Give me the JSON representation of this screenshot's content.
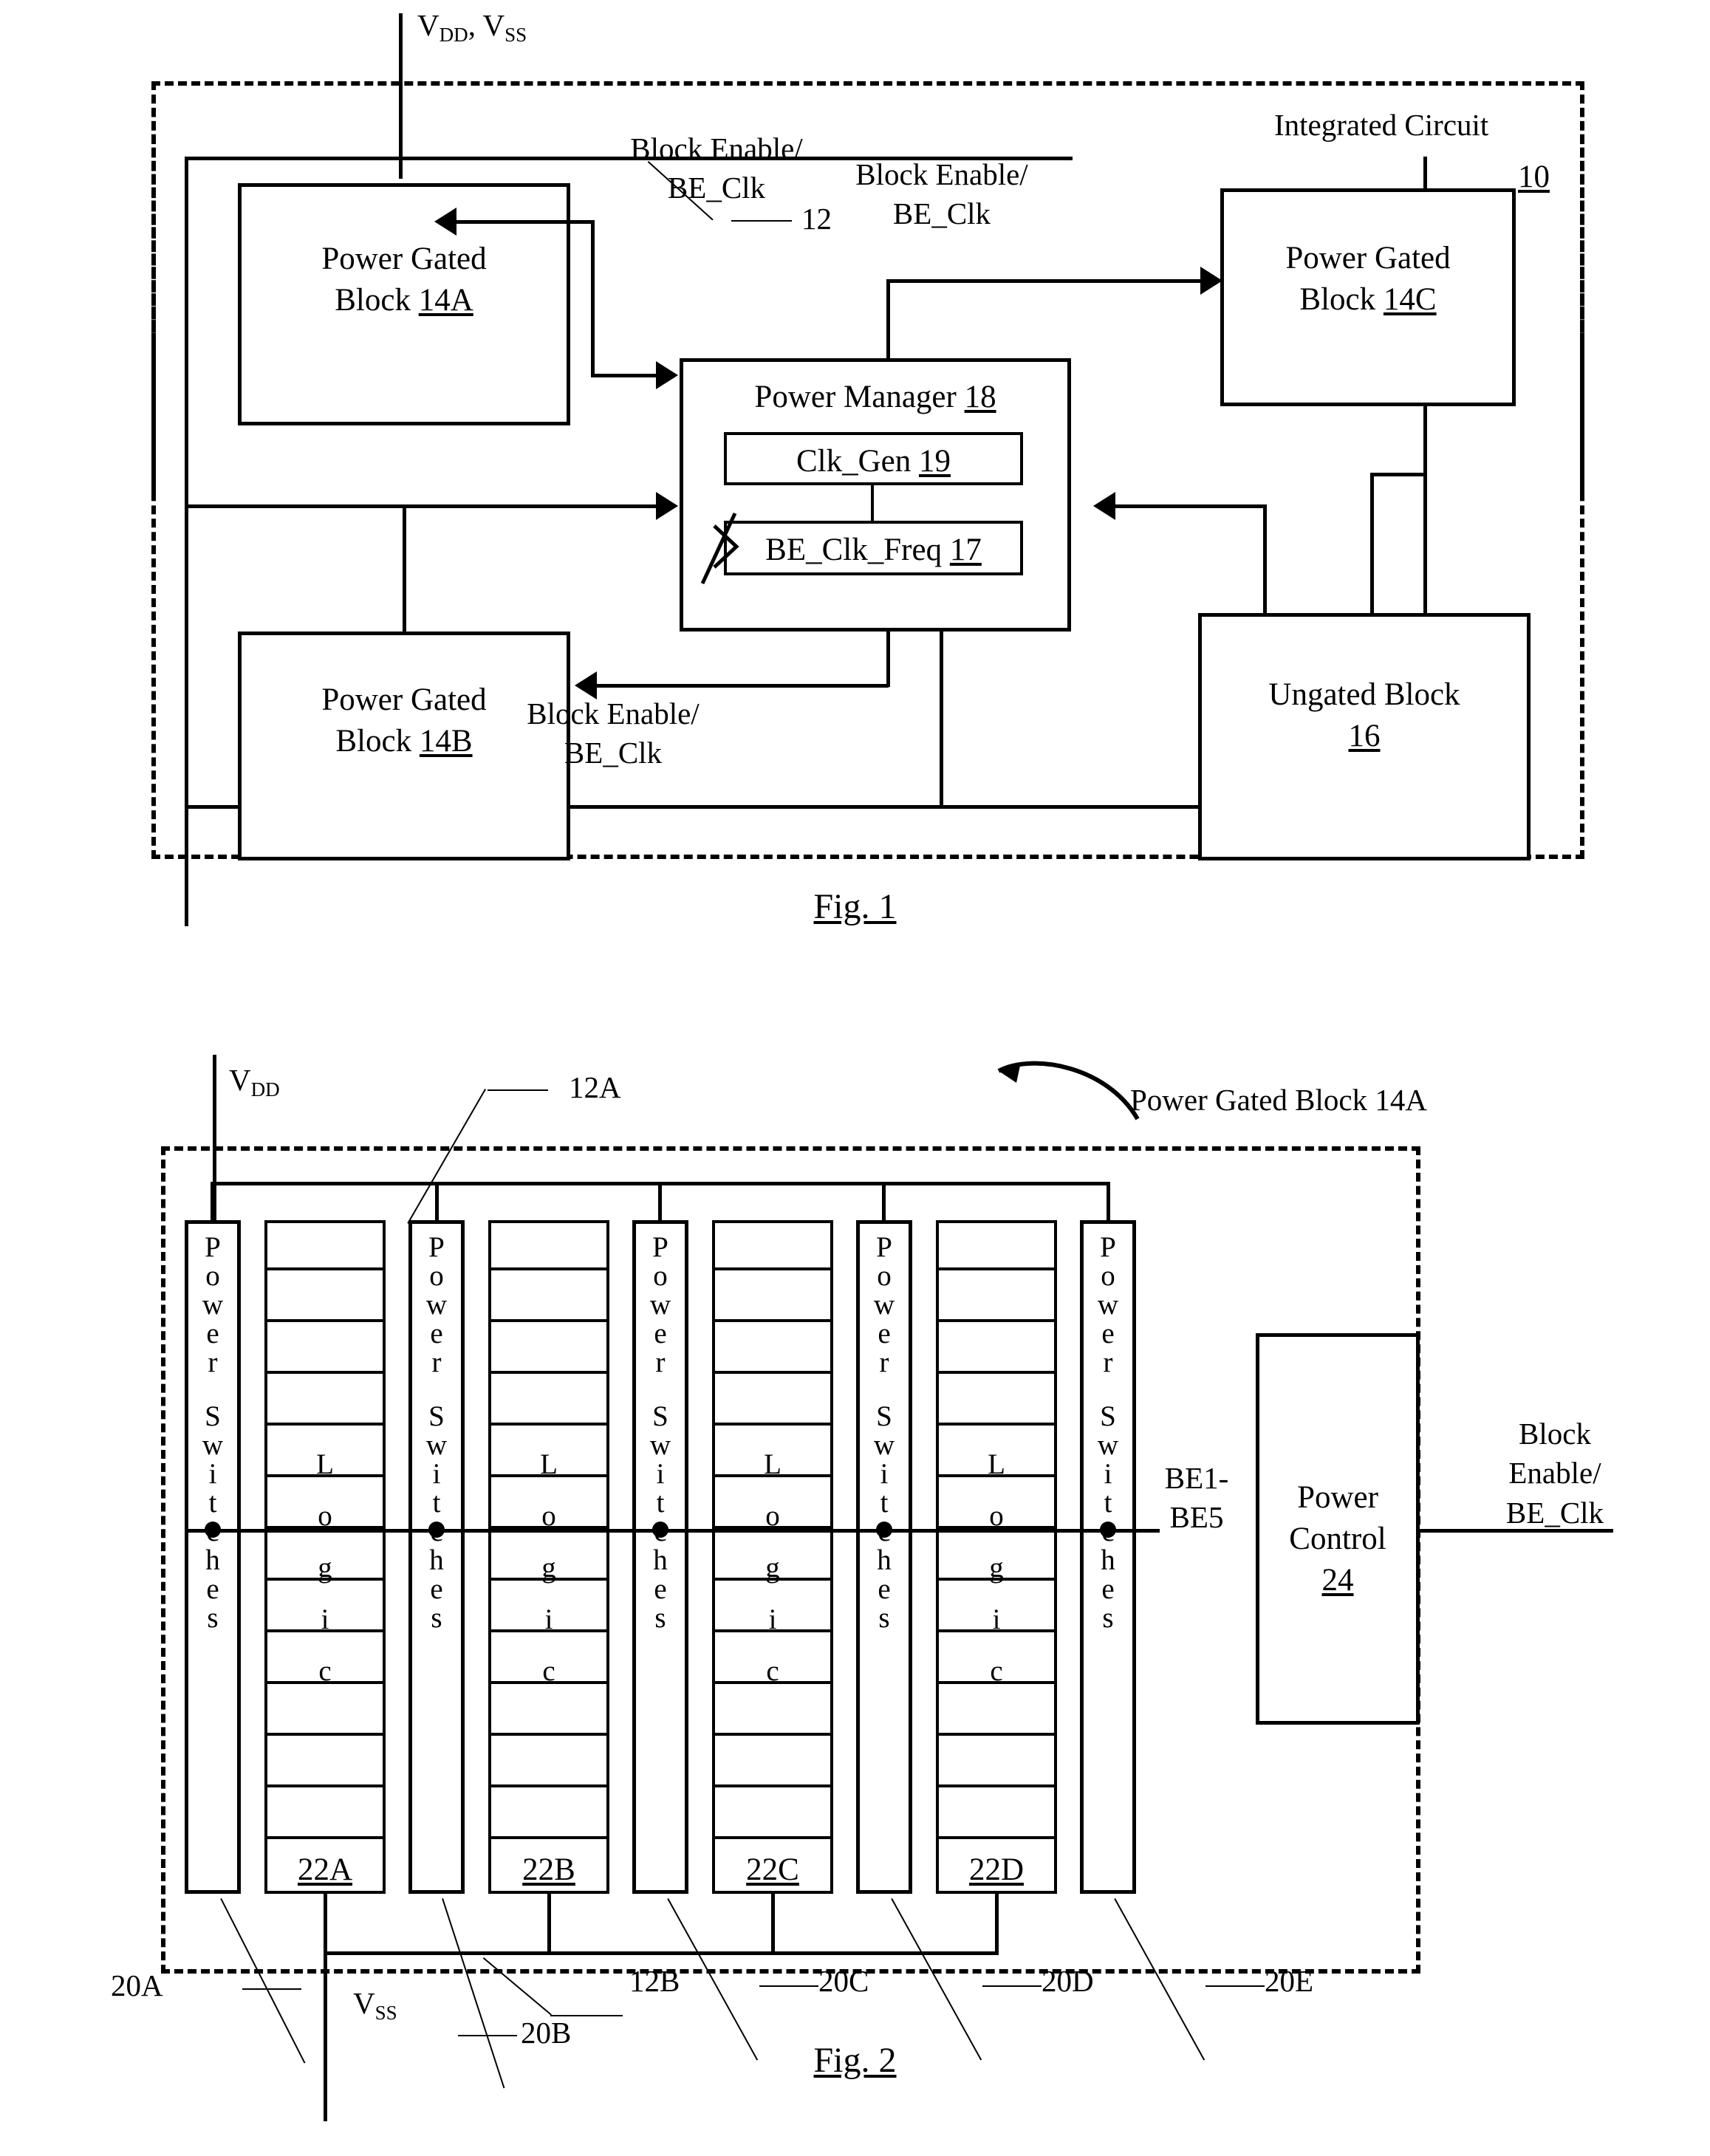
{
  "figures": [
    {
      "id": "fig1",
      "caption": "Fig. 1",
      "outer_label": "Integrated Circuit",
      "outer_ref": "10",
      "supply_label_v": "V",
      "supply_label_dd": "DD",
      "supply_label_comma": ", V",
      "supply_label_ss": "SS",
      "bus_ref": "12",
      "signal_label_line1": "Block Enable/",
      "signal_label_line2": "BE_Clk",
      "blocks": [
        {
          "name": "Power Gated",
          "name2": "Block",
          "ref": "14A"
        },
        {
          "name": "Power Gated",
          "name2": "Block",
          "ref": "14C"
        },
        {
          "name": "Power Gated",
          "name2": "Block",
          "ref": "14B"
        },
        {
          "name": "Ungated Block",
          "name2": "",
          "ref": "16"
        }
      ],
      "power_manager": {
        "title": "Power Manager",
        "ref": "18",
        "sub_blocks": [
          {
            "label": "Clk_Gen",
            "ref": "19"
          },
          {
            "label": "BE_Clk_Freq",
            "ref": "17"
          }
        ]
      }
    },
    {
      "id": "fig2",
      "caption": "Fig. 2",
      "title_callout": "Power Gated Block 14A",
      "supply_top_v": "V",
      "supply_top_dd": "DD",
      "supply_bottom_v": "V",
      "supply_bottom_ss": "SS",
      "bus_top_ref": "12A",
      "bus_bottom_ref": "12B",
      "switch_column_text": "Power Switches",
      "logic_column_text": "Logic",
      "logic_refs": [
        "22A",
        "22B",
        "22C",
        "22D"
      ],
      "switch_refs": [
        "20A",
        "20B",
        "20C",
        "20D",
        "20E"
      ],
      "be_bus_label_line1": "BE1-",
      "be_bus_label_line2": "BE5",
      "power_control": {
        "line1": "Power",
        "line2": "Control",
        "ref": "24"
      },
      "out_signal_line1": "Block",
      "out_signal_line2": "Enable/",
      "out_signal_line3": "BE_Clk"
    }
  ]
}
